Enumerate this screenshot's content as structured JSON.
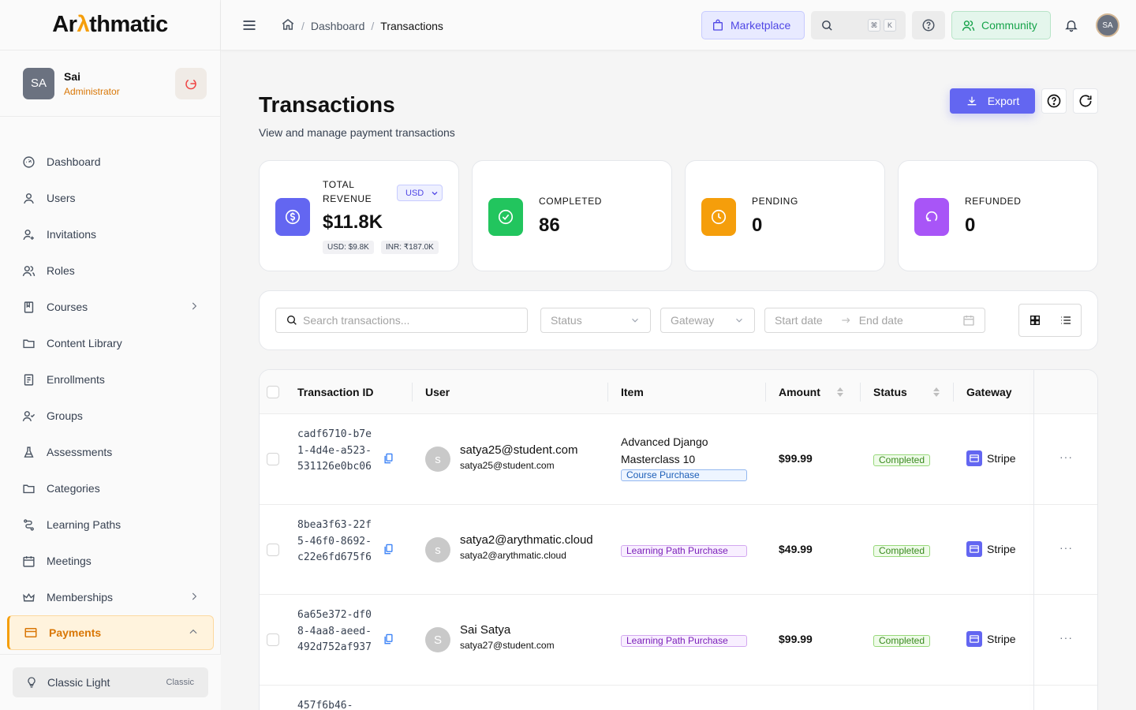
{
  "brand": {
    "prefix": "Ar",
    "accent": "λ",
    "suffix": "thmatic"
  },
  "user": {
    "initials": "SA",
    "name": "Sai",
    "role": "Administrator"
  },
  "sidebar": {
    "items": [
      {
        "label": "Dashboard",
        "icon": "gauge-icon"
      },
      {
        "label": "Users",
        "icon": "user-icon"
      },
      {
        "label": "Invitations",
        "icon": "user-plus-icon"
      },
      {
        "label": "Roles",
        "icon": "users-icon"
      },
      {
        "label": "Courses",
        "icon": "book-icon",
        "chevron": "right"
      },
      {
        "label": "Content Library",
        "icon": "folder-icon"
      },
      {
        "label": "Enrollments",
        "icon": "clipboard-icon"
      },
      {
        "label": "Groups",
        "icon": "group-icon"
      },
      {
        "label": "Assessments",
        "icon": "flask-icon"
      },
      {
        "label": "Categories",
        "icon": "folder-icon"
      },
      {
        "label": "Learning Paths",
        "icon": "route-icon"
      },
      {
        "label": "Meetings",
        "icon": "calendar-icon"
      },
      {
        "label": "Memberships",
        "icon": "crown-icon",
        "chevron": "right"
      },
      {
        "label": "Payments",
        "icon": "credit-card-icon",
        "chevron": "up",
        "active": true
      }
    ],
    "theme": {
      "label": "Classic Light",
      "badge": "Classic"
    }
  },
  "topbar": {
    "breadcrumb": [
      "Dashboard",
      "Transactions"
    ],
    "marketplace": "Marketplace",
    "shortcut": [
      "⌘",
      "K"
    ],
    "community": "Community",
    "avatar": "SA"
  },
  "page": {
    "title": "Transactions",
    "subtitle": "View and manage payment transactions",
    "export": "Export"
  },
  "stats": {
    "revenue": {
      "label": "TOTAL REVENUE",
      "currency": "USD",
      "value": "$11.8K",
      "chips": [
        "USD: $9.8K",
        "INR: ₹187.0K"
      ]
    },
    "completed": {
      "label": "COMPLETED",
      "value": "86"
    },
    "pending": {
      "label": "PENDING",
      "value": "0"
    },
    "refunded": {
      "label": "REFUNDED",
      "value": "0"
    }
  },
  "filters": {
    "search_placeholder": "Search transactions...",
    "status": "Status",
    "gateway": "Gateway",
    "start": "Start date",
    "end": "End date"
  },
  "table": {
    "headers": [
      "Transaction ID",
      "User",
      "Item",
      "Amount",
      "Status",
      "Gateway"
    ],
    "rows": [
      {
        "id": "cadf6710-b7e1-4d4e-a523-531126e0bc06",
        "initial": "s",
        "name": "satya25@student.com",
        "email": "satya25@student.com",
        "item": "Advanced Django Masterclass 10",
        "tag": "Course Purchase",
        "amount": "$99.99",
        "status": "Completed",
        "gateway": "Stripe"
      },
      {
        "id": "8bea3f63-22f5-46f0-8692-c22e6fd675f6",
        "initial": "s",
        "name": "satya2@arythmatic.cloud",
        "email": "satya2@arythmatic.cloud",
        "item": "",
        "tag": "Learning Path Purchase",
        "amount": "$49.99",
        "status": "Completed",
        "gateway": "Stripe"
      },
      {
        "id": "6a65e372-df08-4aa8-aeed-492d752af937",
        "initial": "S",
        "name": "Sai Satya",
        "email": "satya27@student.com",
        "item": "",
        "tag": "Learning Path Purchase",
        "amount": "$99.99",
        "status": "Completed",
        "gateway": "Stripe"
      },
      {
        "id": "457f6b46-",
        "initial": "",
        "name": "",
        "email": "",
        "item": "",
        "tag": "",
        "amount": "",
        "status": "",
        "gateway": ""
      }
    ]
  },
  "colors": {
    "accent": "#6366f1",
    "brand": "#f59e0b",
    "completed": "#22c55e",
    "pending": "#f59e0b",
    "refunded": "#a855f7"
  }
}
